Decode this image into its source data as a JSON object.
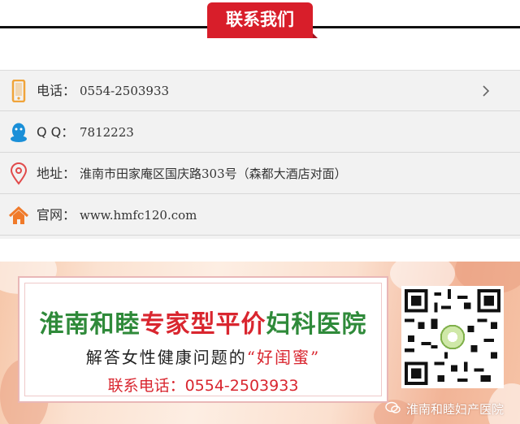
{
  "header": {
    "title": "联系我们"
  },
  "contacts": [
    {
      "label": "电话：",
      "value": "0554-2503933",
      "icon": "phone-icon",
      "color": "#f0a43a"
    },
    {
      "label": "Q Q：",
      "value": "7812223",
      "icon": "qq-icon",
      "color": "#1a8fd8"
    },
    {
      "label": "地址：",
      "value": "淮南市田家庵区国庆路303号（森都大酒店对面）",
      "icon": "location-pin-icon",
      "color": "#e14b4b"
    },
    {
      "label": "官网：",
      "value": "www.hmfc120.com",
      "icon": "home-icon",
      "color": "#f07a2a"
    }
  ],
  "banner": {
    "title_green_1": "淮南和睦",
    "title_red": "专家型平价",
    "title_green_2": "妇科医院",
    "subtitle_prefix": "解答女性健康问题的",
    "subtitle_quote": "“好闺蜜”",
    "phone": "联系电话：0554-2503933",
    "watermark": "淮南和睦妇产医院"
  },
  "colors": {
    "accent": "#d81e2a",
    "green": "#2f8a3a",
    "red": "#d9262f"
  }
}
